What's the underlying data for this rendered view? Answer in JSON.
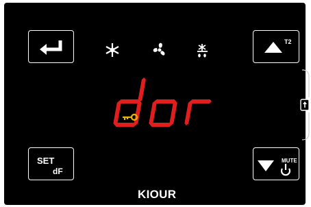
{
  "display": {
    "reading": "dor",
    "segment_color": "#e01e1e",
    "key_indicator_color": "#e8b800",
    "key_indicator": "key-icon"
  },
  "status_icons": [
    "snowflake-icon",
    "fan-icon",
    "defrost-icon"
  ],
  "buttons": {
    "enter": {
      "icon": "enter-arrow-icon"
    },
    "up": {
      "icon": "up-triangle-icon",
      "label": "T2"
    },
    "set": {
      "label": "SET",
      "sublabel": "dF"
    },
    "down": {
      "icon": "down-triangle-icon",
      "label": "MUTE",
      "sublabel_icon": "power-icon"
    }
  },
  "brand": "KIOUR"
}
